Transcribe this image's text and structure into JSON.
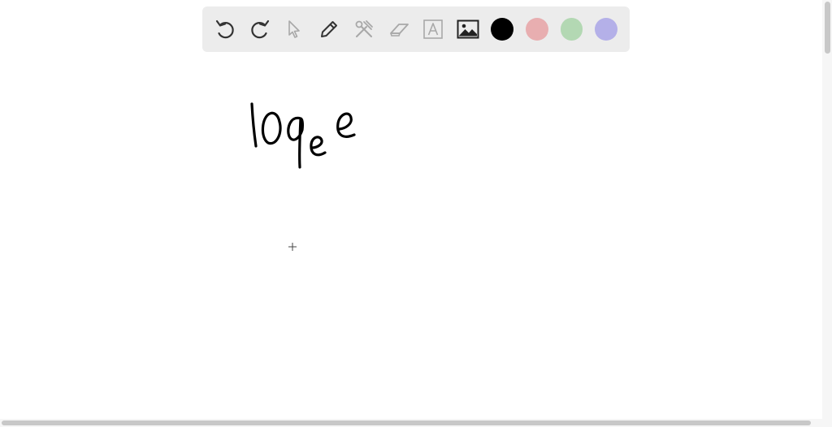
{
  "toolbar": {
    "tools": [
      {
        "name": "undo",
        "icon": "undo-icon",
        "enabled": true
      },
      {
        "name": "redo",
        "icon": "redo-icon",
        "enabled": true
      },
      {
        "name": "select",
        "icon": "cursor-icon",
        "enabled": false
      },
      {
        "name": "pen",
        "icon": "pen-icon",
        "enabled": true
      },
      {
        "name": "tools",
        "icon": "tools-icon",
        "enabled": false
      },
      {
        "name": "eraser",
        "icon": "eraser-icon",
        "enabled": false
      },
      {
        "name": "text",
        "icon": "text-box-icon",
        "enabled": false
      },
      {
        "name": "image",
        "icon": "image-icon",
        "enabled": true
      }
    ],
    "colors": [
      "#000000",
      "#e8aeb0",
      "#b3d8b3",
      "#b4b0e8"
    ],
    "selected_color": "#000000"
  },
  "canvas": {
    "handwriting": "loge e",
    "cursor": "crosshair"
  }
}
